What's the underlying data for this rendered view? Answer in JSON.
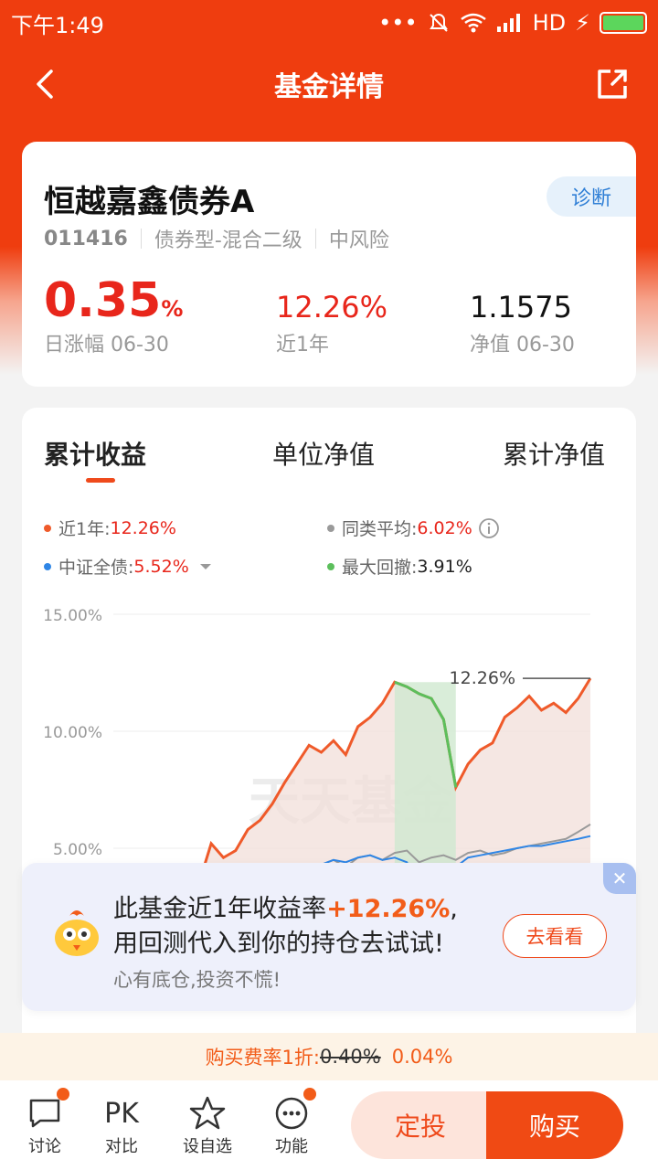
{
  "status": {
    "time": "下午1:49",
    "network": "HD"
  },
  "nav": {
    "title": "基金详情"
  },
  "fund": {
    "name": "恒越嘉鑫债券A",
    "diagnose_label": "诊断",
    "code": "011416",
    "type": "债券型-混合二级",
    "risk": "中风险",
    "daily_change": "0.35",
    "daily_change_unit": "%",
    "daily_change_label": "日涨幅 06-30",
    "year_return": "12.26%",
    "year_return_label": "近1年",
    "nav_value": "1.1575",
    "nav_label": "净值 06-30"
  },
  "tabs": [
    "累计收益",
    "单位净值",
    "累计净值"
  ],
  "legend": {
    "fund_label": "近1年:",
    "fund_value": "12.26%",
    "peer_label": "同类平均:",
    "peer_value": "6.02%",
    "index_label": "中证全债:",
    "index_value": "5.52%",
    "drawdown_label": "最大回撤:",
    "drawdown_value": "3.91%"
  },
  "colors": {
    "fund": "#ef5a2a",
    "peer": "#9a9a9a",
    "index": "#2f86e6",
    "drawdown": "#5cbf5c",
    "accent": "#f04a14"
  },
  "chart_data": {
    "type": "line",
    "ylim": [
      0,
      15
    ],
    "yticks": [
      "15.00%",
      "10.00%",
      "5.00%"
    ],
    "end_label": "12.26%",
    "watermark": "天天基金",
    "series": [
      {
        "name": "近1年",
        "values": [
          0,
          0.2,
          0.4,
          0.6,
          1.0,
          1.5,
          2.0,
          3.5,
          5.2,
          4.6,
          4.9,
          5.8,
          6.2,
          6.9,
          7.8,
          8.6,
          9.4,
          9.1,
          9.6,
          9.0,
          10.2,
          10.6,
          11.2,
          12.1,
          11.9,
          11.6,
          11.4,
          10.5,
          7.6,
          8.6,
          9.2,
          9.5,
          10.6,
          11.0,
          11.5,
          10.9,
          11.2,
          10.8,
          11.4,
          12.26
        ]
      },
      {
        "name": "同类平均",
        "values": [
          0,
          0.1,
          0.3,
          0.5,
          0.8,
          1.2,
          1.6,
          2.3,
          2.8,
          3.0,
          3.2,
          3.4,
          3.6,
          3.5,
          3.9,
          4.1,
          3.6,
          4.3,
          4.5,
          4.2,
          4.6,
          4.7,
          4.5,
          4.8,
          4.9,
          4.4,
          4.6,
          4.7,
          4.5,
          4.8,
          4.9,
          4.7,
          4.8,
          5.0,
          5.1,
          5.2,
          5.3,
          5.4,
          5.7,
          6.02
        ]
      },
      {
        "name": "中证全债",
        "values": [
          1.0,
          1.2,
          1.3,
          1.4,
          1.6,
          1.9,
          2.3,
          2.4,
          2.6,
          2.8,
          3.0,
          3.1,
          3.2,
          3.3,
          3.5,
          3.8,
          4.0,
          4.3,
          4.5,
          4.4,
          4.6,
          4.7,
          4.5,
          4.6,
          4.4,
          3.4,
          3.7,
          3.8,
          4.2,
          4.6,
          4.7,
          4.8,
          4.9,
          5.0,
          5.1,
          5.1,
          5.2,
          5.3,
          5.4,
          5.52
        ]
      }
    ],
    "drawdown_range": [
      23,
      28
    ]
  },
  "popup": {
    "line1_prefix": "此基金近1年收益率",
    "line1_highlight": "+12.26%",
    "line1_suffix": ",",
    "line2": "用回测代入到你的持仓去试试!",
    "line3": "心有底仓,投资不慌!",
    "button": "去看看"
  },
  "fee": {
    "prefix": "购买费率1折:",
    "old": "0.40%",
    "new": "0.04%"
  },
  "bottom_nav": {
    "discuss": "讨论",
    "compare_icon_text": "PK",
    "compare": "对比",
    "watch": "设自选",
    "function": "功能",
    "sip": "定投",
    "buy": "购买"
  }
}
